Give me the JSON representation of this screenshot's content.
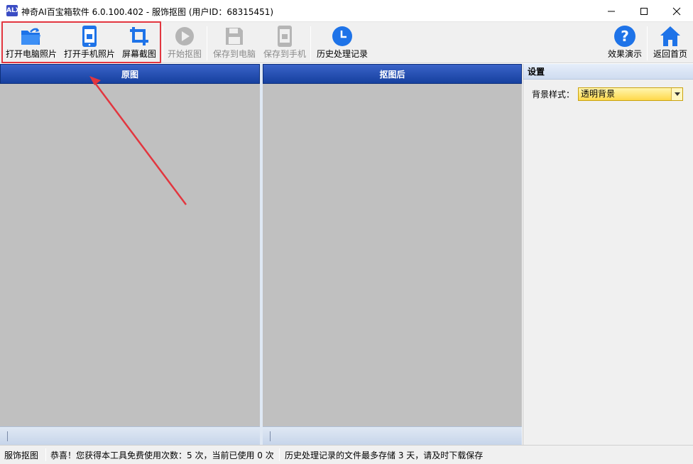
{
  "window": {
    "title": "神奇AI百宝箱软件 6.0.100.402 - 服饰抠图 (用户ID：68315451)",
    "app_icon_text": "ALX"
  },
  "toolbar": {
    "open_pc": "打开电脑照片",
    "open_phone": "打开手机照片",
    "screenshot": "屏幕截图",
    "start_cutout": "开始抠图",
    "save_pc": "保存到电脑",
    "save_phone": "保存到手机",
    "history": "历史处理记录",
    "demo": "效果演示",
    "home": "返回首页"
  },
  "panels": {
    "original": "原图",
    "result": "抠图后"
  },
  "settings": {
    "title": "设置",
    "bg_label": "背景样式：",
    "bg_value": "透明背景"
  },
  "status": {
    "mode": "服饰抠图",
    "usage": "恭喜！您获得本工具免费使用次数：5 次，当前已使用 0 次",
    "history_note": "历史处理记录的文件最多存储 3 天，请及时下载保存"
  },
  "colors": {
    "accent_blue": "#1e73e8",
    "header_blue": "#16409f",
    "annotation_red": "#e2363f",
    "select_yellow": "#ffd84a"
  }
}
